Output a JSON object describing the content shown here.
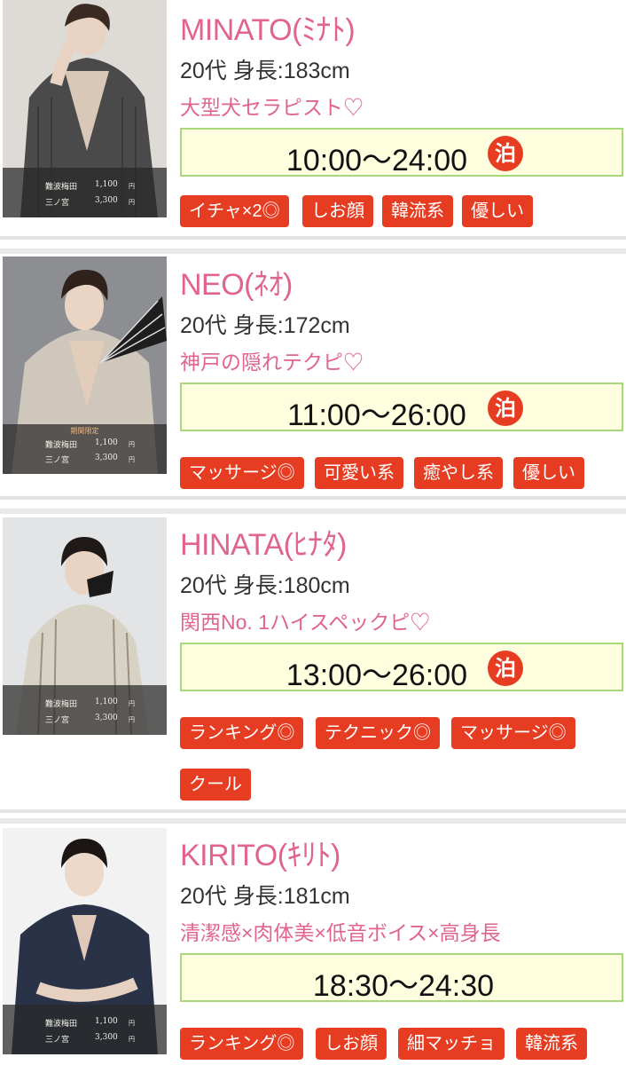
{
  "casts": [
    {
      "name": "MINATO(ﾐﾅﾄ)",
      "info": "20代 身長:183cm",
      "catch": "大型犬セラピスト♡",
      "hours": "10:00〜24:00",
      "stay": "泊",
      "limited": "",
      "prices": [
        {
          "loc": "難波梅田",
          "amt": "1,100",
          "unit": "円"
        },
        {
          "loc": "三ノ宮",
          "amt": "3,300",
          "unit": "円"
        }
      ],
      "tags": [
        "イチャ×2◎",
        "しお顔",
        "韓流系",
        "優しい"
      ]
    },
    {
      "name": "NEO(ﾈｵ)",
      "info": "20代 身長:172cm",
      "catch": "神戸の隠れテクピ♡",
      "hours": "11:00〜26:00",
      "stay": "泊",
      "limited": "期間限定",
      "prices": [
        {
          "loc": "難波梅田",
          "amt": "1,100",
          "unit": "円"
        },
        {
          "loc": "三ノ宮",
          "amt": "3,300",
          "unit": "円"
        }
      ],
      "tags": [
        "マッサージ◎",
        "可愛い系",
        "癒やし系",
        "優しい"
      ]
    },
    {
      "name": "HINATA(ﾋﾅﾀ)",
      "info": "20代 身長:180cm",
      "catch": "関西No. 1ハイスペックピ♡",
      "hours": "13:00〜26:00",
      "stay": "泊",
      "limited": "",
      "prices": [
        {
          "loc": "難波梅田",
          "amt": "1,100",
          "unit": "円"
        },
        {
          "loc": "三ノ宮",
          "amt": "3,300",
          "unit": "円"
        }
      ],
      "tags": [
        "ランキング◎",
        "テクニック◎",
        "マッサージ◎",
        "クール"
      ]
    },
    {
      "name": "KIRITO(ｷﾘﾄ)",
      "info": "20代 身長:181cm",
      "catch": "清潔感×肉体美×低音ボイス×高身長",
      "hours": "18:30〜24:30",
      "stay": "",
      "limited": "",
      "prices": [
        {
          "loc": "難波梅田",
          "amt": "1,100",
          "unit": "円"
        },
        {
          "loc": "三ノ宮",
          "amt": "3,300",
          "unit": "円"
        }
      ],
      "tags": [
        "ランキング◎",
        "しお顔",
        "細マッチョ",
        "韓流系"
      ]
    }
  ],
  "colors": {
    "name": "#e0648c",
    "tag_bg": "#e63d22",
    "badge_bg": "#e63d22",
    "hours_bg": "#ffffdf",
    "hours_border": "#a8d87c"
  }
}
